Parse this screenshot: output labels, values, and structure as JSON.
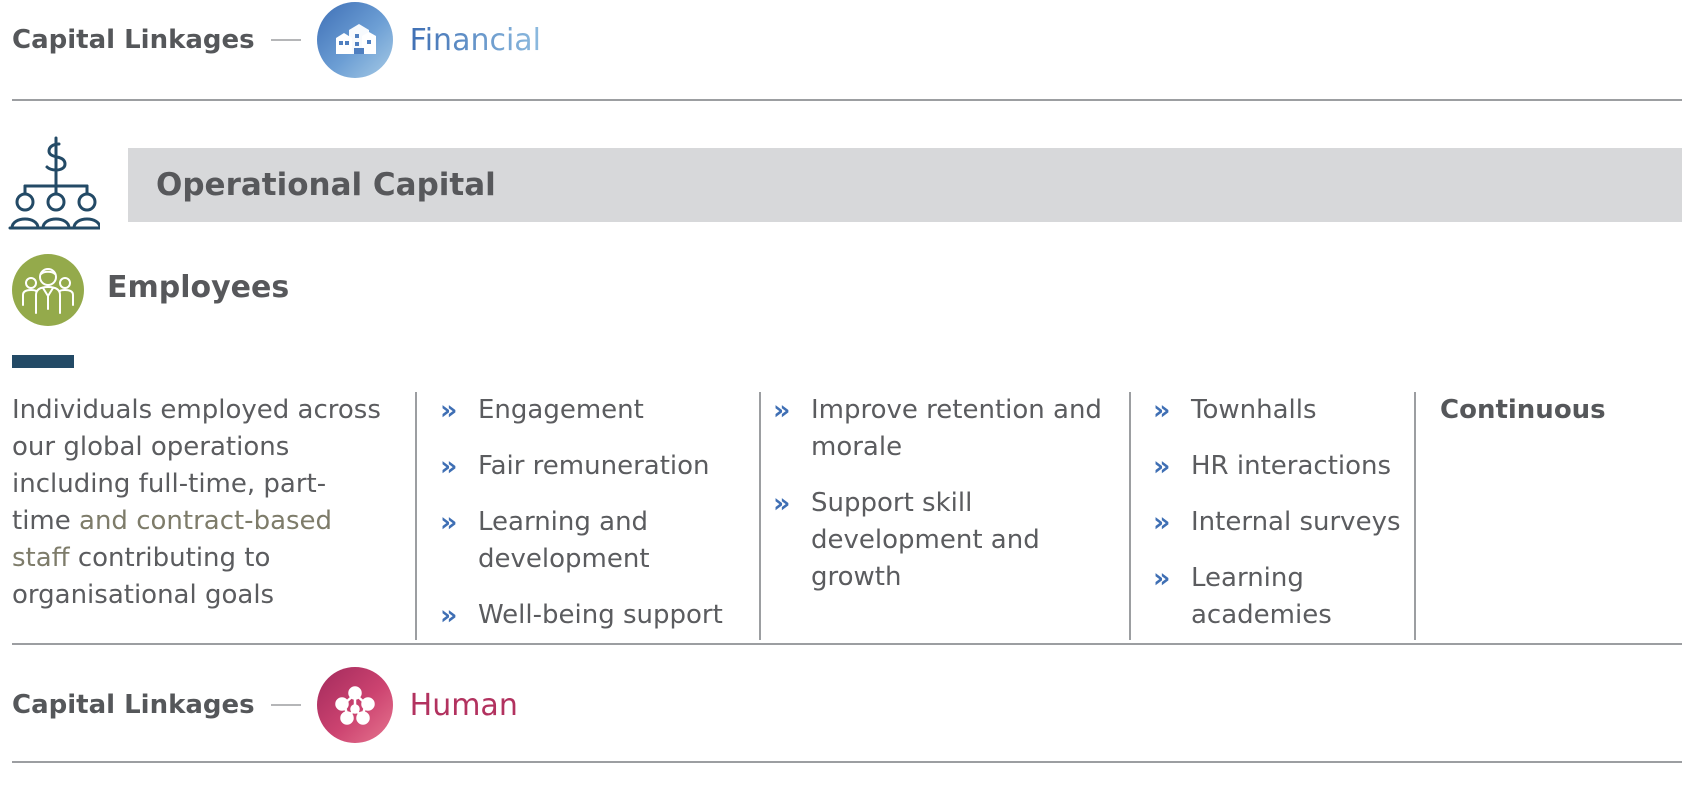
{
  "top_linkage": {
    "label": "Capital Linkages",
    "icon": "buildings-icon",
    "name": "Financial",
    "color": "#3e6fb6"
  },
  "banner": {
    "title": "Operational Capital",
    "icon": "dollar-org-chart-icon",
    "color": "#234a66"
  },
  "stakeholder": {
    "title": "Employees",
    "icon": "people-group-icon",
    "color": "#94aa4b"
  },
  "description": {
    "part1": "Individuals employed across our global operations including full-time, part-time ",
    "part2": "and contract-based staff",
    "part3": " contributing to organisational goals"
  },
  "chevron_glyph": "»",
  "chevron_color": "#3f6fb4",
  "interests": [
    "Engagement",
    "Fair remuneration",
    "Learning and development",
    "Well-being support"
  ],
  "objectives": [
    "Improve retention and morale",
    "Support skill development and growth"
  ],
  "channels": [
    "Townhalls",
    "HR interactions",
    "Internal surveys",
    "Learning academies"
  ],
  "frequency": "Continuous",
  "bottom_linkage": {
    "label": "Capital Linkages",
    "icon": "network-nodes-icon",
    "name": "Human",
    "color": "#b2325f"
  }
}
